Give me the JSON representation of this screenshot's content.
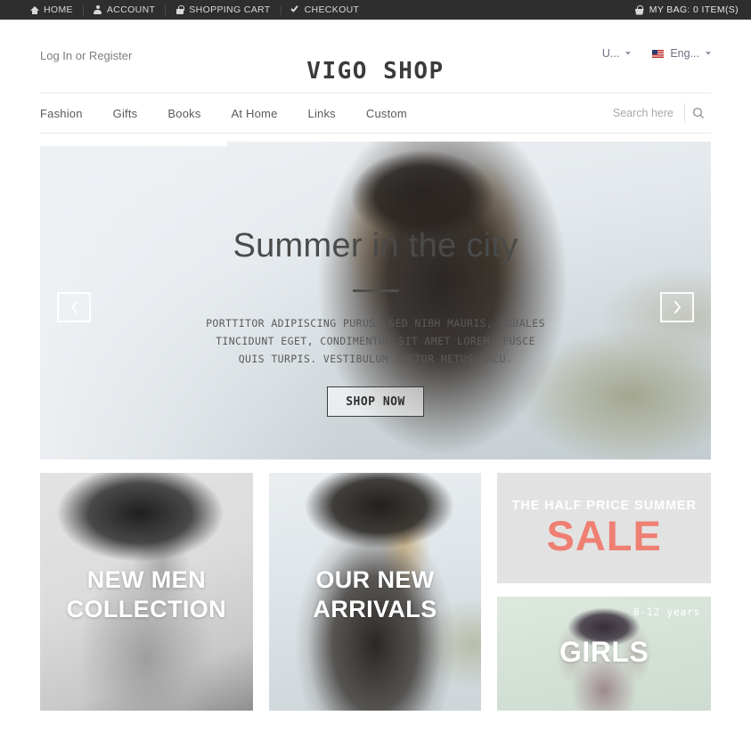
{
  "topbar": {
    "links": [
      {
        "label": "HOME",
        "icon": "home-icon"
      },
      {
        "label": "ACCOUNT",
        "icon": "person-icon"
      },
      {
        "label": "SHOPPING CART",
        "icon": "lock-icon"
      },
      {
        "label": "CHECKOUT",
        "icon": "check-icon"
      }
    ],
    "bag": {
      "label": "MY BAG: 0 ITEM(S)",
      "icon": "basket-icon"
    }
  },
  "header": {
    "login_label": "Log In or Register",
    "brand": "VIGO SHOP",
    "currency_selector": {
      "label": "U...",
      "icon": "chevron-down-icon"
    },
    "language_selector": {
      "label": "Eng...",
      "icon": "chevron-down-icon",
      "flag": "us-flag-icon"
    }
  },
  "nav": {
    "items": [
      {
        "label": "Fashion"
      },
      {
        "label": "Gifts"
      },
      {
        "label": "Books"
      },
      {
        "label": "At Home"
      },
      {
        "label": "Links"
      },
      {
        "label": "Custom"
      }
    ],
    "search": {
      "placeholder": "Search here",
      "value": "",
      "icon": "search-icon"
    }
  },
  "hero": {
    "title": "Summer in the city",
    "body": "PORTTITOR ADIPISCING PURUS. SED NIBH MAURIS, SODALES TINCIDUNT EGET, CONDIMENTUM SIT AMET LOREM. FUSCE QUIS TURPIS. VESTIBULUM AUCTOR METUS ARCU.",
    "cta_label": "SHOP NOW",
    "prev_icon": "chevron-left-icon",
    "next_icon": "chevron-right-icon"
  },
  "promos": {
    "men": {
      "line1": "NEW MEN",
      "line2": "COLLECTION"
    },
    "arrivals": {
      "line1": "OUR NEW",
      "line2": "ARRIVALS"
    },
    "sale": {
      "sub": "THE HALF PRICE SUMMER",
      "main": "SALE"
    },
    "girls": {
      "label": "GIRLS",
      "age": "8-12 years"
    }
  },
  "colors": {
    "topbar_bg": "#2e2e2e",
    "sale_accent": "#ef7f72",
    "sale_bg": "#e2e2e2",
    "text_dark": "#3b3b3b"
  }
}
